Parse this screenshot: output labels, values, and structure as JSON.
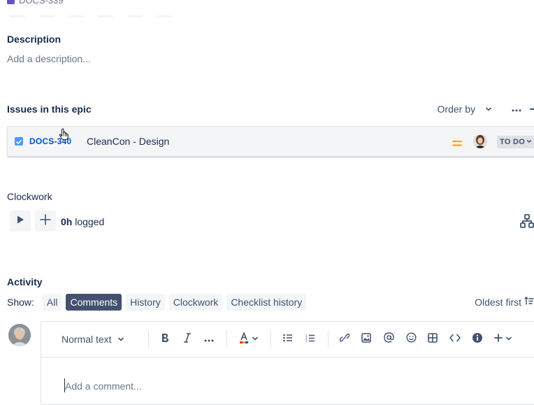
{
  "top": {
    "issue_key_partial": "DOCS-339"
  },
  "description": {
    "title": "Description",
    "placeholder": "Add a description..."
  },
  "epic_issues": {
    "title": "Issues in this epic",
    "order_by_label": "Order by",
    "issues": [
      {
        "key": "DOCS-340",
        "summary": "CleanCon - Design",
        "priority": "medium",
        "status": "TO DO",
        "checked": true
      }
    ]
  },
  "clockwork": {
    "title": "Clockwork",
    "logged_value": "0h",
    "logged_suffix": "logged"
  },
  "activity": {
    "title": "Activity",
    "show_label": "Show:",
    "filters": [
      {
        "label": "All",
        "active": false
      },
      {
        "label": "Comments",
        "active": true
      },
      {
        "label": "History",
        "active": false
      },
      {
        "label": "Clockwork",
        "active": false
      },
      {
        "label": "Checklist history",
        "active": false
      }
    ],
    "sort_label": "Oldest first"
  },
  "editor": {
    "text_style": "Normal text",
    "placeholder": "Add a comment..."
  },
  "colors": {
    "link": "#0052cc",
    "active_chip": "#42526e",
    "priority_medium": "#ffab00",
    "epic": "#6554c0",
    "checkbox": "#4c9aff"
  }
}
